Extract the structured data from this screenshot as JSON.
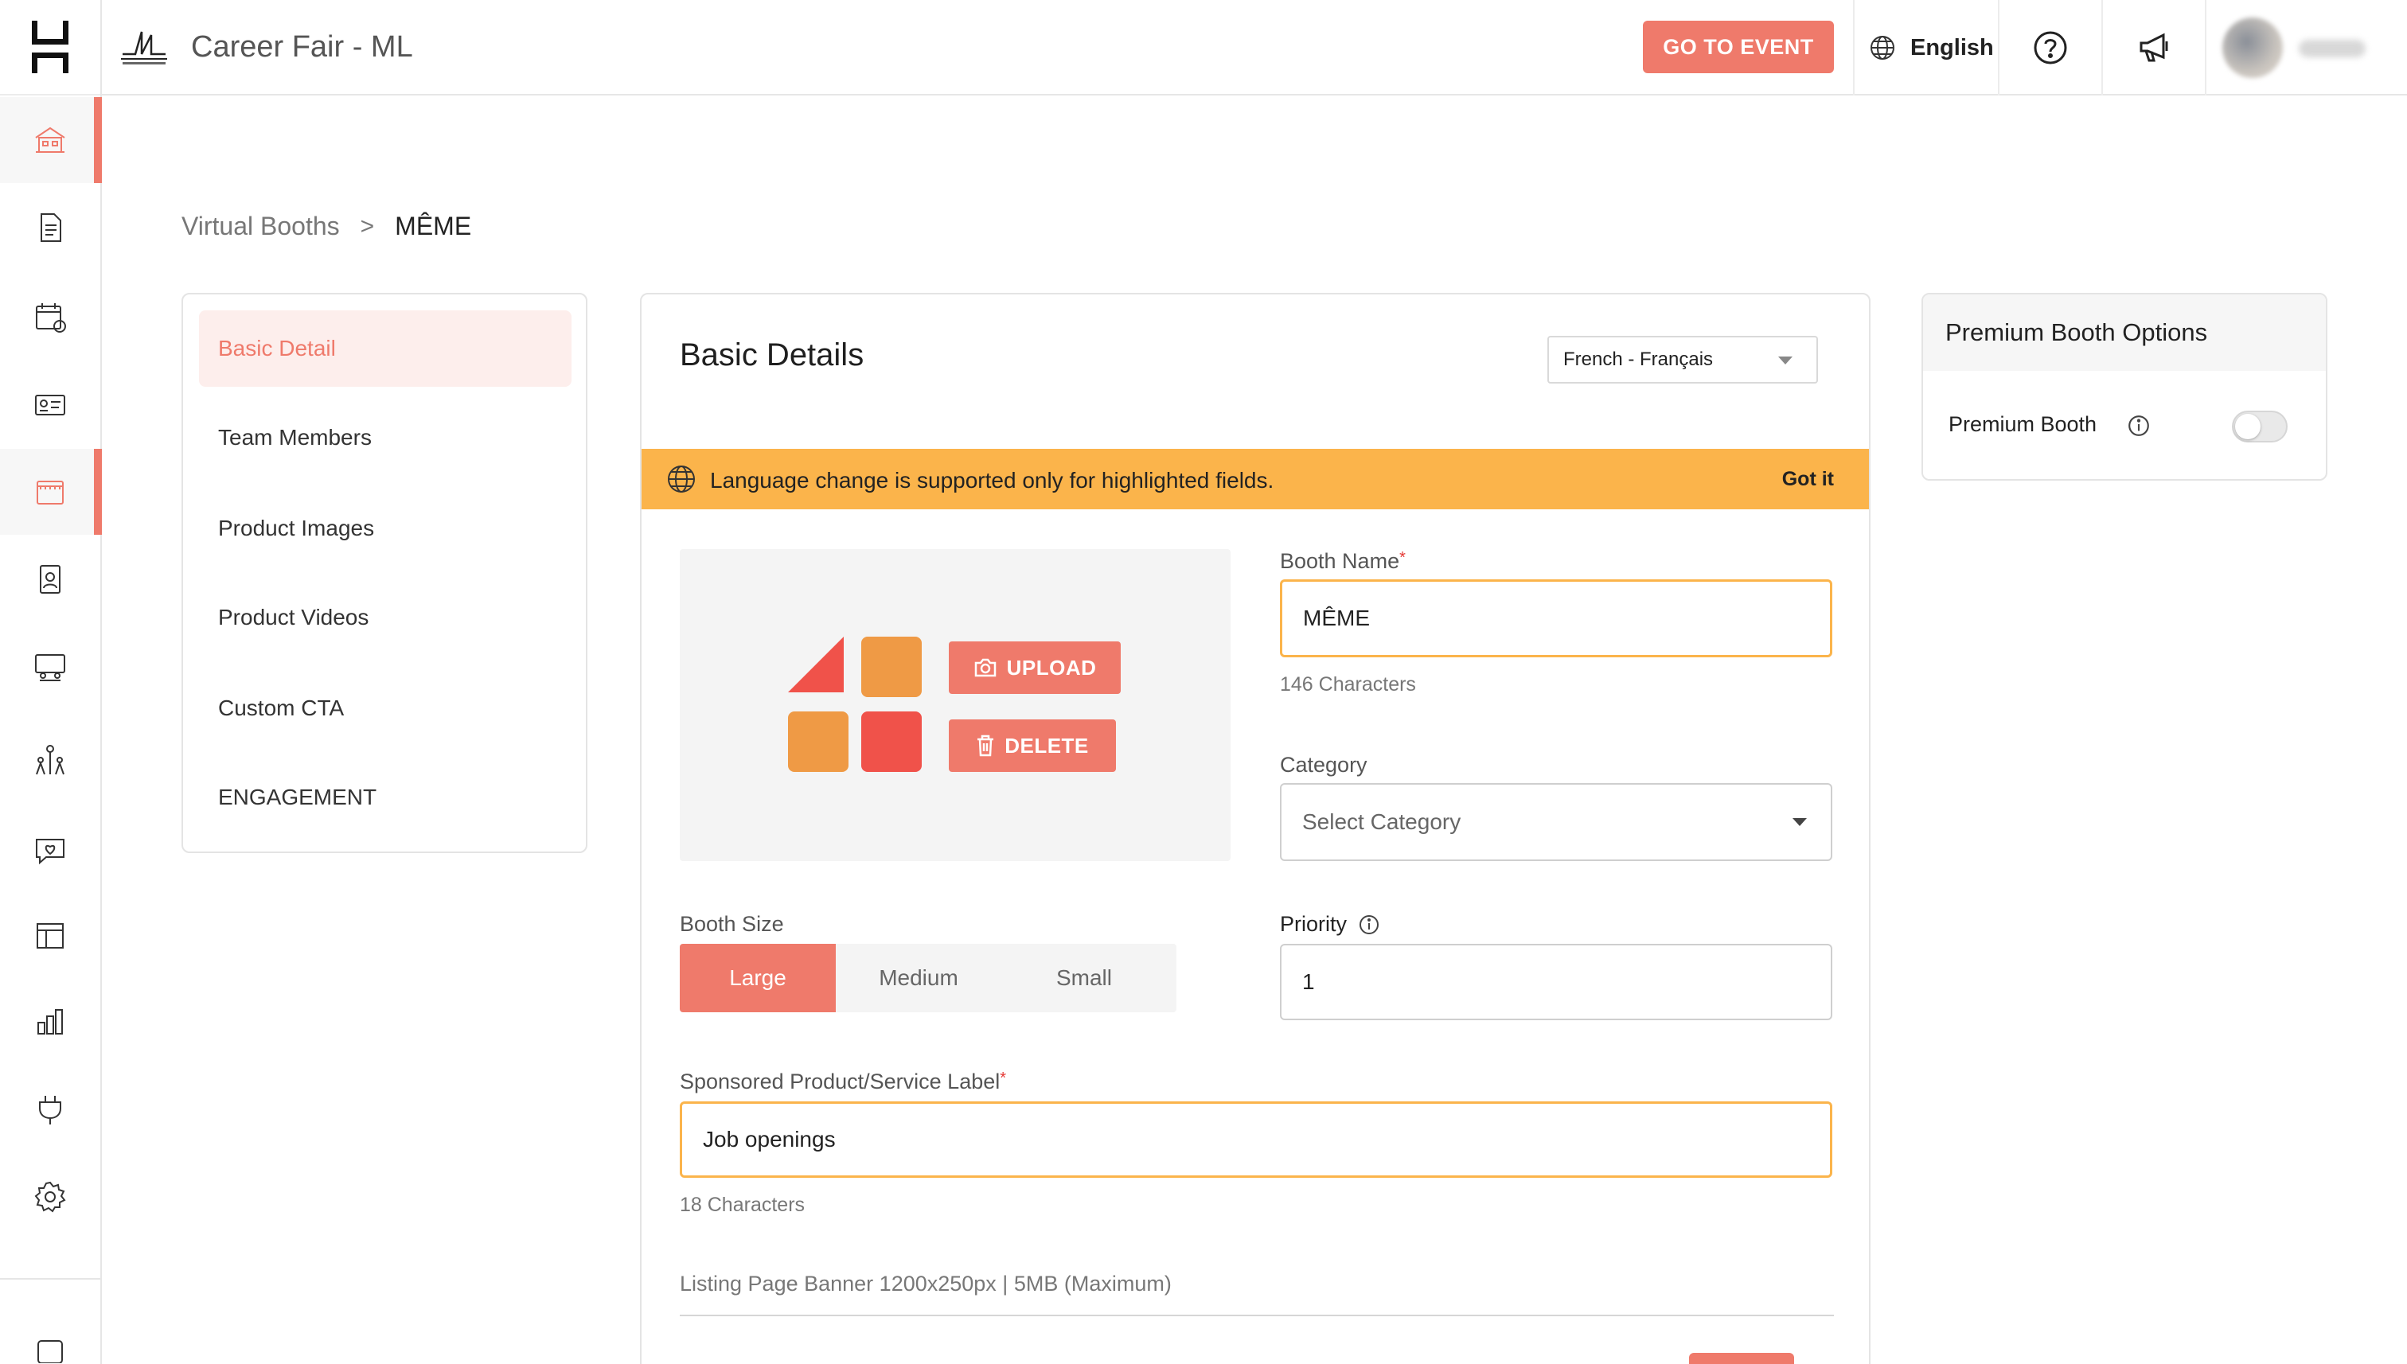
{
  "topbar": {
    "event_title": "Career Fair - ML",
    "go_to_event_label": "GO TO EVENT",
    "language_label": "English"
  },
  "rail": {
    "items": [
      "home-icon",
      "document-icon",
      "calendar-icon",
      "id-card-icon",
      "booth-icon",
      "badge-icon",
      "lounge-icon",
      "networking-icon",
      "engagement-icon",
      "layout-icon",
      "analytics-icon",
      "integrations-icon",
      "settings-icon"
    ],
    "active": [
      "home-icon",
      "booth-icon"
    ]
  },
  "breadcrumb": {
    "parent": "Virtual Booths",
    "separator": ">",
    "current": "MÊME"
  },
  "section_nav": {
    "items": [
      "Basic Detail",
      "Team Members",
      "Product Images",
      "Product Videos",
      "Custom CTA",
      "ENGAGEMENT"
    ],
    "active_index": 0
  },
  "main": {
    "title": "Basic Details",
    "language_select_value": "French - Français",
    "banner_text": "Language change is supported only for highlighted fields.",
    "banner_dismiss": "Got it",
    "upload_label": "UPLOAD",
    "delete_label": "DELETE",
    "booth_name": {
      "label": "Booth Name",
      "required_mark": "*",
      "value": "MÊME",
      "helper": "146 Characters"
    },
    "category": {
      "label": "Category",
      "placeholder": "Select Category"
    },
    "booth_size": {
      "label": "Booth Size",
      "options": [
        "Large",
        "Medium",
        "Small"
      ],
      "selected": "Large"
    },
    "priority": {
      "label": "Priority",
      "value": "1"
    },
    "sponsored_label": {
      "label": "Sponsored Product/Service Label",
      "required_mark": "*",
      "value": "Job openings",
      "helper": "18 Characters"
    },
    "listing_banner_label": "Listing Page Banner 1200x250px | 5MB (Maximum)"
  },
  "premium": {
    "title": "Premium Booth Options",
    "row_label": "Premium Booth",
    "toggle_on": false
  },
  "colors": {
    "accent": "#ef7a6b",
    "banner": "#fbb44b",
    "logo_red": "#f0524a",
    "logo_orange": "#ef9a45"
  }
}
